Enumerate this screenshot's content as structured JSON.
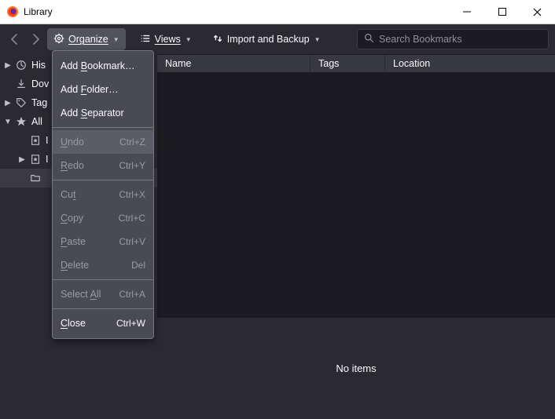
{
  "window": {
    "title": "Library"
  },
  "toolbar": {
    "organize": "Organize",
    "views": "Views",
    "import": "Import and Backup"
  },
  "search": {
    "placeholder": "Search Bookmarks"
  },
  "columns": {
    "name": "Name",
    "tags": "Tags",
    "location": "Location"
  },
  "sidebar": {
    "history": "His",
    "downloads": "Dov",
    "tags": "Tag",
    "all_bookmarks": "All",
    "item_a": "I",
    "item_b": "I",
    "item_c": ""
  },
  "details": {
    "empty": "No items"
  },
  "menu": {
    "add_bookmark": {
      "pre": "Add ",
      "u": "B",
      "post": "ookmark…"
    },
    "add_folder": {
      "pre": "Add ",
      "u": "F",
      "post": "older…"
    },
    "add_separator": {
      "pre": "Add ",
      "u": "S",
      "post": "eparator"
    },
    "undo": {
      "pre": "",
      "u": "U",
      "post": "ndo",
      "accel": "Ctrl+Z"
    },
    "redo": {
      "pre": "",
      "u": "R",
      "post": "edo",
      "accel": "Ctrl+Y"
    },
    "cut": {
      "pre": "Cu",
      "u": "t",
      "post": "",
      "accel": "Ctrl+X"
    },
    "copy": {
      "pre": "",
      "u": "C",
      "post": "opy",
      "accel": "Ctrl+C"
    },
    "paste": {
      "pre": "",
      "u": "P",
      "post": "aste",
      "accel": "Ctrl+V"
    },
    "delete": {
      "pre": "",
      "u": "D",
      "post": "elete",
      "accel": "Del"
    },
    "select_all": {
      "pre": "Select ",
      "u": "A",
      "post": "ll",
      "accel": "Ctrl+A"
    },
    "close": {
      "pre": "",
      "u": "C",
      "post": "lose",
      "accel": "Ctrl+W"
    }
  }
}
